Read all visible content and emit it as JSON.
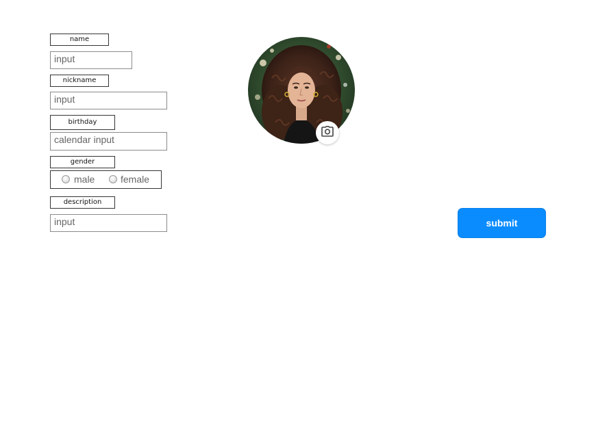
{
  "form": {
    "name": {
      "label": "name",
      "value": "input"
    },
    "nickname": {
      "label": "nickname",
      "value": "input"
    },
    "birthday": {
      "label": "birthday",
      "value": "calendar input"
    },
    "gender": {
      "label": "gender",
      "options": [
        "male",
        "female"
      ],
      "selected": null
    },
    "description": {
      "label": "description",
      "value": "input"
    }
  },
  "avatar": {
    "icon": "camera-icon"
  },
  "actions": {
    "submit_label": "submit"
  },
  "colors": {
    "accent": "#0a8cff",
    "label_border": "#333333",
    "input_border": "#8a8a8a",
    "placeholder_text": "#666666"
  }
}
